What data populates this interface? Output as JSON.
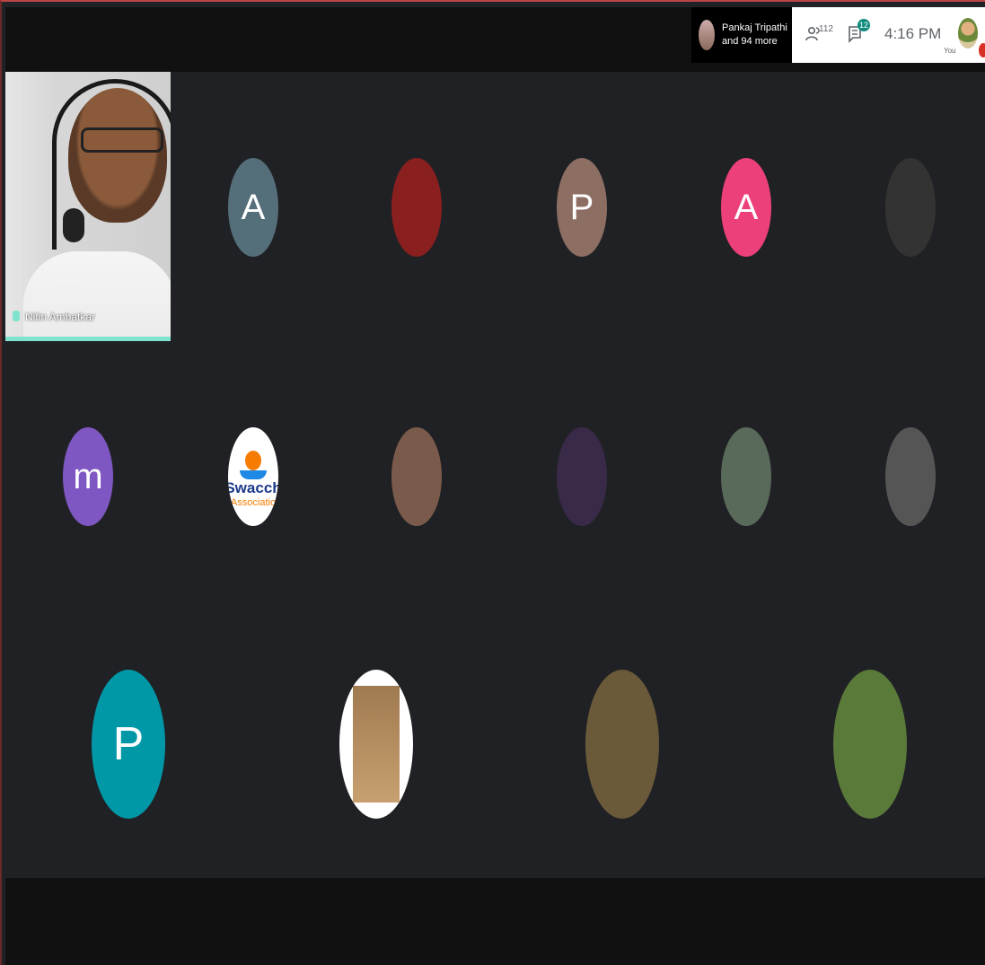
{
  "header": {
    "raised_hand_name": "Pankaj Tripathi",
    "raised_hand_more": "and 94 more",
    "people_count": "112",
    "chat_count": "12",
    "time": "4:16 PM",
    "self_label": "You"
  },
  "speaker_tile": {
    "name": "Nitin Ambatkar"
  },
  "avatars": [
    {
      "letter": "A",
      "color": "#546e7a"
    },
    {
      "letter": "",
      "color": "#8a1f1f"
    },
    {
      "letter": "P",
      "color": "#8d6e63"
    },
    {
      "letter": "A",
      "color": "#ec407a"
    },
    {
      "letter": "",
      "color": "#333333"
    },
    {
      "letter": "m",
      "color": "#7e57c2"
    },
    {
      "letter": "",
      "color": "#ffffff",
      "logo_text": "Swacch",
      "logo_sub": "Associatio"
    },
    {
      "letter": "",
      "color": "#7a5a4a"
    },
    {
      "letter": "",
      "color": "#3a2a4a"
    },
    {
      "letter": "",
      "color": "#5a6a5a"
    },
    {
      "letter": "",
      "color": "#555555"
    },
    {
      "letter": "P",
      "color": "#0097a7"
    },
    {
      "letter": "",
      "color": "#c79a5a"
    },
    {
      "letter": "",
      "color": "#6a5a3a"
    },
    {
      "letter": "",
      "color": "#5a7a3a"
    }
  ]
}
